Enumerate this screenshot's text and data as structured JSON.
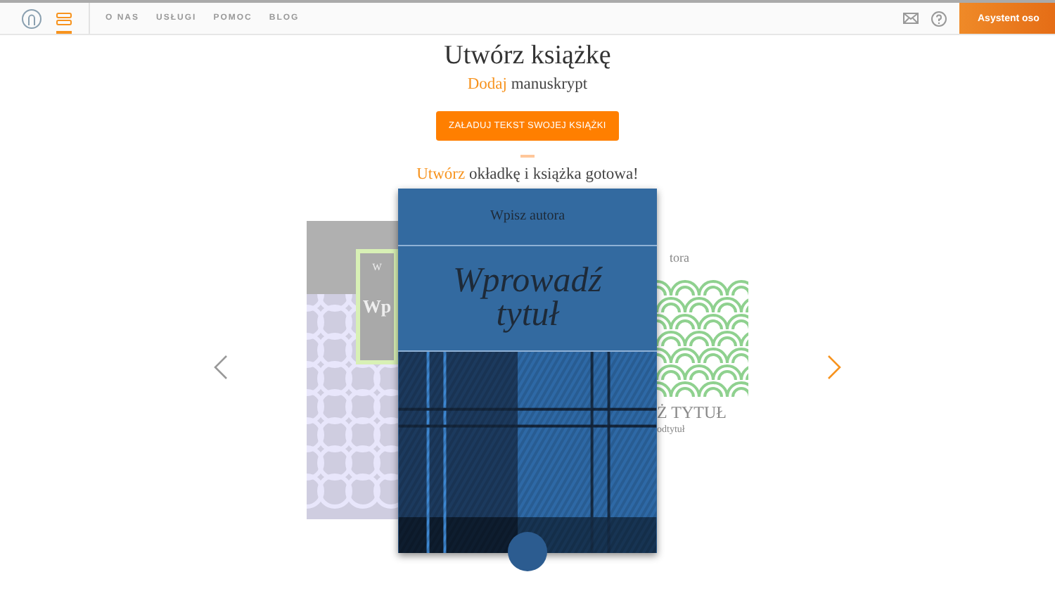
{
  "nav": {
    "items": [
      {
        "label": "O NAS"
      },
      {
        "label": "USŁUGI"
      },
      {
        "label": "POMOC"
      },
      {
        "label": "BLOG"
      }
    ]
  },
  "assistant_button": "Asystent oso",
  "heading": "Utwórz książkę",
  "step1": {
    "highlight": "Dodaj",
    "text": "manuskrypt"
  },
  "upload_button": "ZAŁADUJ TEKST SWOJEJ KSIĄŻKI",
  "step2": {
    "highlight": "Utwórz",
    "text": "okładkę i książka gotowa!"
  },
  "carousel": {
    "covers": [
      {
        "kind": "lattice",
        "author": "W",
        "title": "Wp"
      },
      {
        "kind": "plaid",
        "author": "Wpisz autora",
        "title": "Wprowadź tytuł"
      },
      {
        "kind": "waves",
        "author": "tora",
        "title": "Ż TYTUŁ",
        "subtitle": "odtytuł"
      }
    ]
  }
}
